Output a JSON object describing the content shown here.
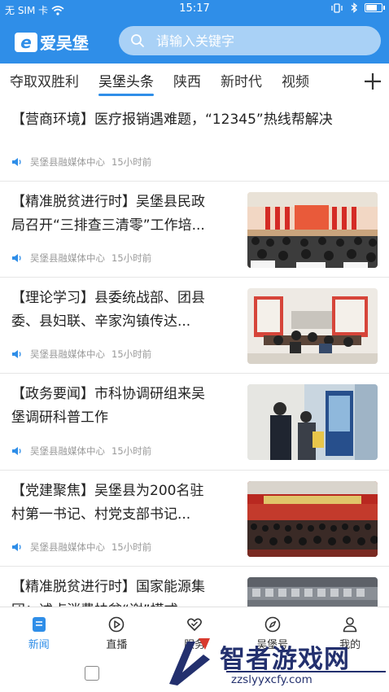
{
  "status": {
    "carrier": "无 SIM 卡",
    "time": "15:17",
    "battery_level": 0.75
  },
  "header": {
    "logo_text": "爱吴堡",
    "search_placeholder": "请输入关键字"
  },
  "tabs": [
    {
      "label": "夺取双胜利",
      "active": false
    },
    {
      "label": "吴堡头条",
      "active": true
    },
    {
      "label": "陕西",
      "active": false
    },
    {
      "label": "新时代",
      "active": false
    },
    {
      "label": "视频",
      "active": false
    }
  ],
  "news": [
    {
      "title_line1": "【营商环境】医疗报销遇难题，“12345”热线帮解决",
      "title_line2": "",
      "source": "吴堡县融媒体中心",
      "time": "15小时前",
      "has_thumb": false
    },
    {
      "title_line1": "【精准脱贫进行时】吴堡县民政",
      "title_line2": "局召开“三排查三清零”工作培...",
      "source": "吴堡县融媒体中心",
      "time": "15小时前",
      "has_thumb": true,
      "thumb": "meeting-hall"
    },
    {
      "title_line1": "【理论学习】县委统战部、团县",
      "title_line2": "委、县妇联、辛家沟镇传达...",
      "source": "吴堡县融媒体中心",
      "time": "15小时前",
      "has_thumb": true,
      "thumb": "study-room"
    },
    {
      "title_line1": "【政务要闻】市科协调研组来吴",
      "title_line2": "堡调研科普工作",
      "source": "吴堡县融媒体中心",
      "time": "15小时前",
      "has_thumb": true,
      "thumb": "exhibit"
    },
    {
      "title_line1": "【党建聚焦】吴堡县为200名驻",
      "title_line2": "村第一书记、村党支部书记...",
      "source": "吴堡县融媒体中心",
      "time": "15小时前",
      "has_thumb": true,
      "thumb": "auditorium"
    },
    {
      "title_line1": "【精准脱贫进行时】国家能源集",
      "title_line2": "团：述卢消费扶贫“谢”模式",
      "source": "",
      "time": "",
      "has_thumb": true,
      "thumb": "building"
    }
  ],
  "bottom_nav": [
    {
      "label": "新闻",
      "icon": "news-icon",
      "active": true
    },
    {
      "label": "直播",
      "icon": "play-icon",
      "active": false
    },
    {
      "label": "服务",
      "icon": "heart-service-icon",
      "active": false
    },
    {
      "label": "吴堡号",
      "icon": "compass-icon",
      "active": false
    },
    {
      "label": "我的",
      "icon": "person-icon",
      "active": false
    }
  ],
  "watermark": {
    "text": "智者游戏网",
    "url": "zzslyyxcfy.com"
  },
  "colors": {
    "brand_blue": "#2f8ee8",
    "search_bg": "#a9d1f6",
    "meta_gray": "#999999",
    "watermark_navy": "#23306e"
  }
}
